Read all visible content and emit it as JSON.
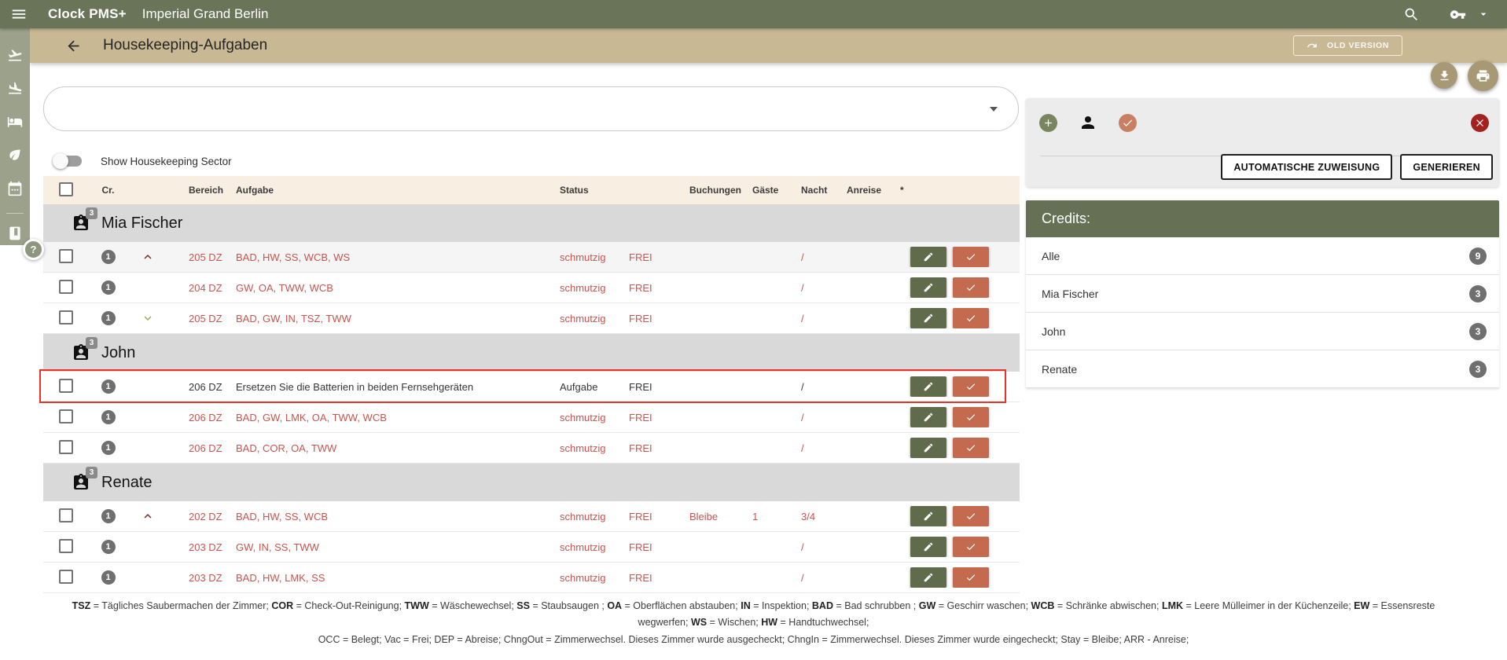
{
  "app_bar": {
    "brand": "Clock PMS+",
    "property": "Imperial Grand Berlin",
    "icons": [
      "menu",
      "search",
      "key",
      "caret-down"
    ]
  },
  "page_header": {
    "title": "Housekeeping-Aufgaben",
    "back_icon": "arrow-back",
    "old_version_label": "OLD VERSION",
    "floating_actions": [
      "download",
      "print"
    ]
  },
  "sidebar": {
    "icons": [
      "flight-takeoff",
      "flight-land",
      "hotel",
      "eco",
      "calendar",
      "divider",
      "book"
    ],
    "help_label": "?"
  },
  "filter": {
    "search_value": "",
    "toggle_label": "Show Housekeeping Sector",
    "toggle_on": false
  },
  "table": {
    "columns": [
      "Cr.",
      "Bereich",
      "Aufgabe",
      "Status",
      "Buchungen",
      "Gäste",
      "Nacht",
      "Anreise",
      "*"
    ],
    "groups": [
      {
        "name": "Mia Fischer",
        "count": "3",
        "rows": [
          {
            "cr": "1",
            "caret": "up",
            "bereich": "205 DZ",
            "aufgabe": "BAD, HW, SS, WCB, WS",
            "status": "schmutzig",
            "belegung": "FREI",
            "buchungen": "",
            "gaeste": "",
            "nacht": "/",
            "anreise": "",
            "star": "",
            "variant": "red",
            "shaded": true,
            "selected": false
          },
          {
            "cr": "1",
            "caret": "none",
            "bereich": "204 DZ",
            "aufgabe": "GW, OA, TWW, WCB",
            "status": "schmutzig",
            "belegung": "FREI",
            "buchungen": "",
            "gaeste": "",
            "nacht": "/",
            "anreise": "",
            "star": "",
            "variant": "red",
            "shaded": false,
            "selected": false
          },
          {
            "cr": "1",
            "caret": "down",
            "bereich": "205 DZ",
            "aufgabe": "BAD, GW, IN, TSZ, TWW",
            "status": "schmutzig",
            "belegung": "FREI",
            "buchungen": "",
            "gaeste": "",
            "nacht": "/",
            "anreise": "",
            "star": "",
            "variant": "red",
            "shaded": false,
            "selected": false
          }
        ]
      },
      {
        "name": "John",
        "count": "3",
        "rows": [
          {
            "cr": "1",
            "caret": "none",
            "bereich": "206 DZ",
            "aufgabe": "Ersetzen Sie die Batterien in beiden Fernsehgeräten",
            "status": "Aufgabe",
            "belegung": "FREI",
            "buchungen": "",
            "gaeste": "",
            "nacht": "/",
            "anreise": "",
            "star": "",
            "variant": "task",
            "shaded": false,
            "selected": true
          },
          {
            "cr": "1",
            "caret": "none",
            "bereich": "206 DZ",
            "aufgabe": "BAD, GW, LMK, OA, TWW, WCB",
            "status": "schmutzig",
            "belegung": "FREI",
            "buchungen": "",
            "gaeste": "",
            "nacht": "/",
            "anreise": "",
            "star": "",
            "variant": "red",
            "shaded": false,
            "selected": false
          },
          {
            "cr": "1",
            "caret": "none",
            "bereich": "206 DZ",
            "aufgabe": "BAD, COR, OA, TWW",
            "status": "schmutzig",
            "belegung": "FREI",
            "buchungen": "",
            "gaeste": "",
            "nacht": "/",
            "anreise": "",
            "star": "",
            "variant": "red",
            "shaded": false,
            "selected": false
          }
        ]
      },
      {
        "name": "Renate",
        "count": "3",
        "rows": [
          {
            "cr": "1",
            "caret": "up",
            "bereich": "202 DZ",
            "aufgabe": "BAD, HW, SS, WCB",
            "status": "schmutzig",
            "belegung": "FREI",
            "buchungen": "Bleibe",
            "gaeste": "1",
            "nacht": "3/4",
            "anreise": "",
            "star": "",
            "variant": "red",
            "shaded": false,
            "selected": false
          },
          {
            "cr": "1",
            "caret": "none",
            "bereich": "203 DZ",
            "aufgabe": "GW, IN, SS, TWW",
            "status": "schmutzig",
            "belegung": "FREI",
            "buchungen": "",
            "gaeste": "",
            "nacht": "/",
            "anreise": "",
            "star": "",
            "variant": "red",
            "shaded": false,
            "selected": false
          },
          {
            "cr": "1",
            "caret": "none",
            "bereich": "203 DZ",
            "aufgabe": "BAD, HW, LMK, SS",
            "status": "schmutzig",
            "belegung": "FREI",
            "buchungen": "",
            "gaeste": "",
            "nacht": "/",
            "anreise": "",
            "star": "",
            "variant": "red",
            "shaded": false,
            "selected": false
          }
        ]
      }
    ]
  },
  "assignment_panel": {
    "icons": [
      "add",
      "person",
      "check-circle",
      "close"
    ],
    "auto_assign_label": "AUTOMATISCHE ZUWEISUNG",
    "generate_label": "GENERIEREN"
  },
  "credits": {
    "title": "Credits:",
    "rows": [
      {
        "name": "Alle",
        "count": "9"
      },
      {
        "name": "Mia Fischer",
        "count": "3"
      },
      {
        "name": "John",
        "count": "3"
      },
      {
        "name": "Renate",
        "count": "3"
      }
    ]
  },
  "legend": {
    "tasks": [
      {
        "abbr": "TSZ",
        "desc": "Tägliches Saubermachen der Zimmer"
      },
      {
        "abbr": "COR",
        "desc": "Check-Out-Reinigung"
      },
      {
        "abbr": "TWW",
        "desc": "Wäschewechsel"
      },
      {
        "abbr": "SS",
        "desc": "Staubsaugen "
      },
      {
        "abbr": "OA",
        "desc": "Oberflächen abstauben"
      },
      {
        "abbr": "IN",
        "desc": "Inspektion"
      },
      {
        "abbr": "BAD",
        "desc": "Bad schrubben "
      },
      {
        "abbr": "GW",
        "desc": "Geschirr waschen"
      },
      {
        "abbr": "WCB",
        "desc": "Schränke abwischen"
      },
      {
        "abbr": "LMK",
        "desc": "Leere Mülleimer in der Küchenzeile"
      },
      {
        "abbr": "EW",
        "desc": "Essensreste wegwerfen"
      },
      {
        "abbr": "WS",
        "desc": "Wischen"
      },
      {
        "abbr": "HW",
        "desc": "Handtuchwechsel"
      }
    ],
    "statuses_line": "OCC = Belegt; Vac = Frei; DEP = Abreise; ChngOut = Zimmerwechsel. Dieses Zimmer wurde ausgecheckt; ChngIn = Zimmerwechsel. Dieses Zimmer wurde eingecheckt; Stay = Bleibe; ARR - Anreise;"
  },
  "colors": {
    "appbar_green": "#6a7459",
    "rail_green": "#9ba18a",
    "header_tan": "#c8b894",
    "table_header_cream": "#f8eee2",
    "group_gray": "#d9d9d9",
    "row_red_text": "#c9544d",
    "selection_red": "#e63227",
    "action_green": "#5f6b4b",
    "action_salmon": "#c36a4f",
    "badge_gray": "#6f6f6f",
    "close_red": "#a32220",
    "credits_green": "#667055",
    "fab_brown": "#a89975"
  }
}
